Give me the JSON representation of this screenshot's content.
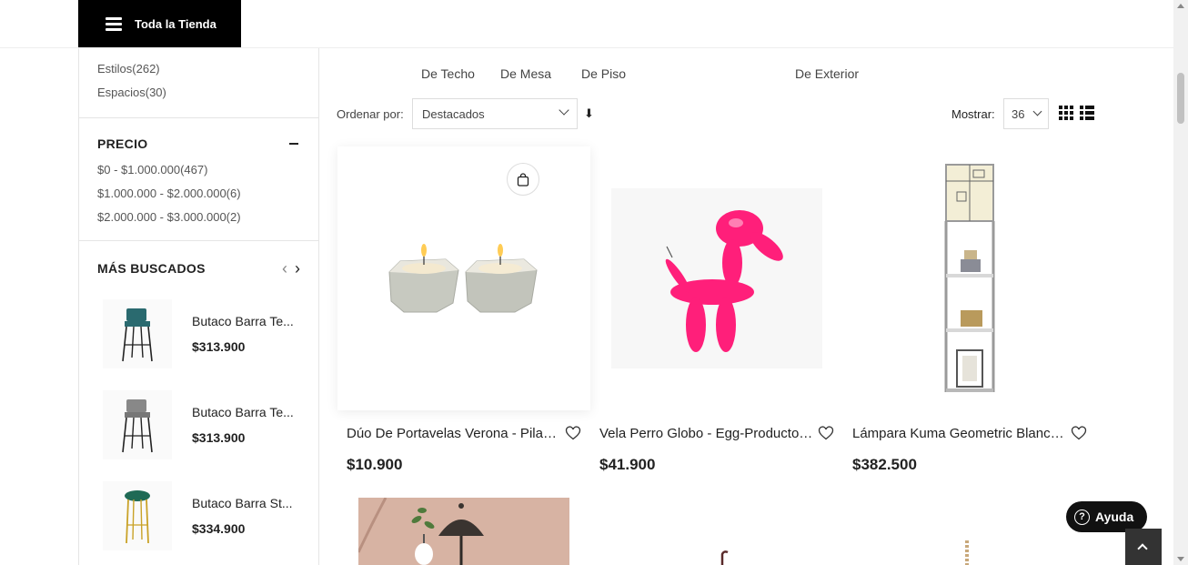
{
  "header": {
    "store_menu_label": "Toda la Tienda"
  },
  "sidebar": {
    "categories": [
      {
        "label": "Estilos(262)"
      },
      {
        "label": "Espacios(30)"
      }
    ],
    "price": {
      "title": "PRECIO",
      "ranges": [
        {
          "label": "$0 - $1.000.000(467)"
        },
        {
          "label": "$1.000.000 - $2.000.000(6)"
        },
        {
          "label": "$2.000.000 - $3.000.000(2)"
        }
      ]
    },
    "mas_buscados": {
      "title": "MÁS BUSCADOS",
      "items": [
        {
          "name": "Butaco Barra Te...",
          "price": "$313.900"
        },
        {
          "name": "Butaco Barra Te...",
          "price": "$313.900"
        },
        {
          "name": "Butaco Barra St...",
          "price": "$334.900"
        }
      ]
    }
  },
  "main": {
    "category_tabs": [
      "De Techo",
      "De Mesa",
      "De Piso",
      "De Exterior"
    ],
    "sort": {
      "label": "Ordenar por:",
      "value": "Destacados",
      "direction_icon": "⬇"
    },
    "show": {
      "label": "Mostrar:",
      "value": "36"
    },
    "products": [
      {
        "name": "Dúo De Portavelas Verona - Pilastro",
        "price": "$10.900"
      },
      {
        "name": "Vela Perro Globo - Egg-Productos Gourmet",
        "price": "$41.900"
      },
      {
        "name": "Lámpara Kuma Geometric Blanca - Lamparas",
        "price": "$382.500"
      }
    ]
  },
  "floating": {
    "help_label": "Ayuda",
    "help_icon": "?"
  },
  "colors": {
    "accent": "#000000",
    "balloon_dog": "#ff1f7a",
    "heart_stroke": "#333333"
  }
}
